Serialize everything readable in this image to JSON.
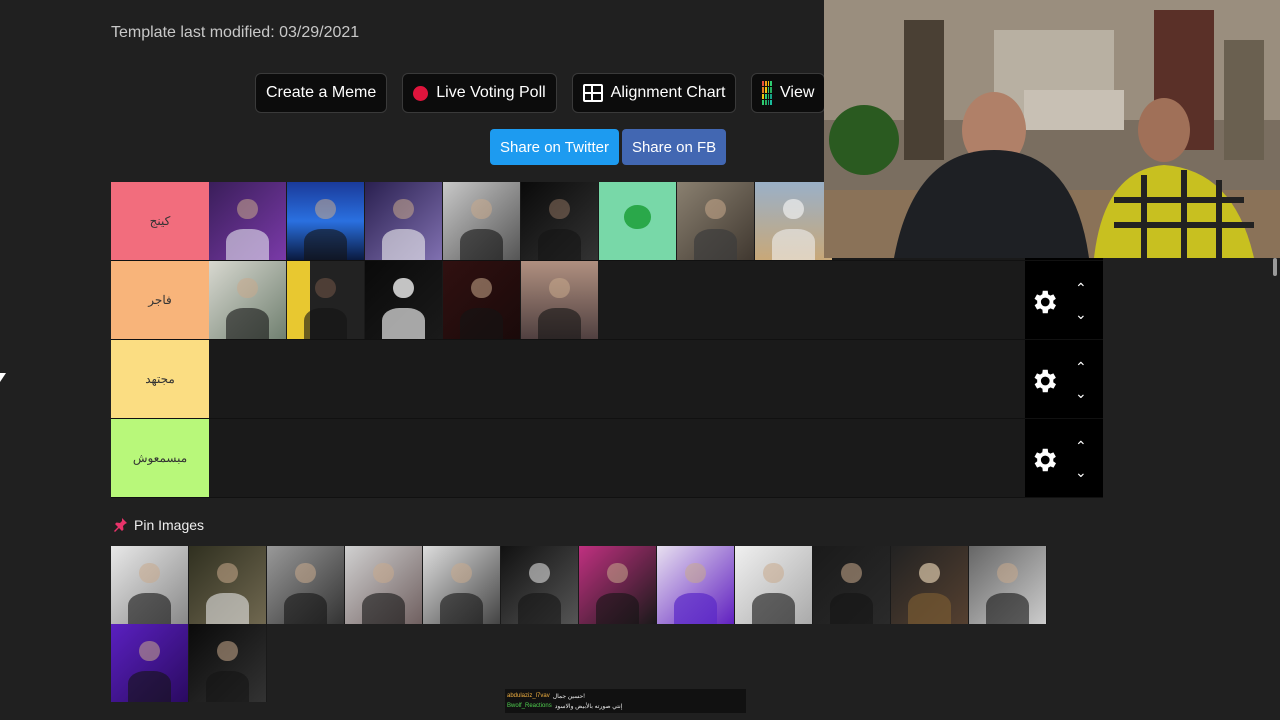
{
  "template": {
    "last_modified": "Template last modified: 03/29/2021"
  },
  "toolbar": {
    "create_meme": "Create a Meme",
    "live_voting": "Live Voting Poll",
    "alignment_chart": "Alignment Chart",
    "view": "View"
  },
  "share": {
    "twitter": "Share on Twitter",
    "fb": "Share on FB"
  },
  "tiers": [
    {
      "label": "كينج",
      "color": "#f26d7d",
      "images": 9
    },
    {
      "label": "فاجر",
      "color": "#f8b47a",
      "images": 5
    },
    {
      "label": "مجتهد",
      "color": "#fbdd82",
      "images": 0
    },
    {
      "label": "مبسمعوش",
      "color": "#b8f87a",
      "images": 0
    }
  ],
  "pin": {
    "title": "Pin Images",
    "count": 14
  },
  "chat": [
    {
      "user": "abdulaziz_l7vav",
      "message": "حسين جمال!"
    },
    {
      "user": "Bwolf_Reactions",
      "message": "إنتي صورته بالأبيض والاسود"
    }
  ],
  "colors": {
    "background": "#202020",
    "twitter": "#1d9bf0",
    "facebook": "#4267b2",
    "live_dot": "#e0143c"
  }
}
